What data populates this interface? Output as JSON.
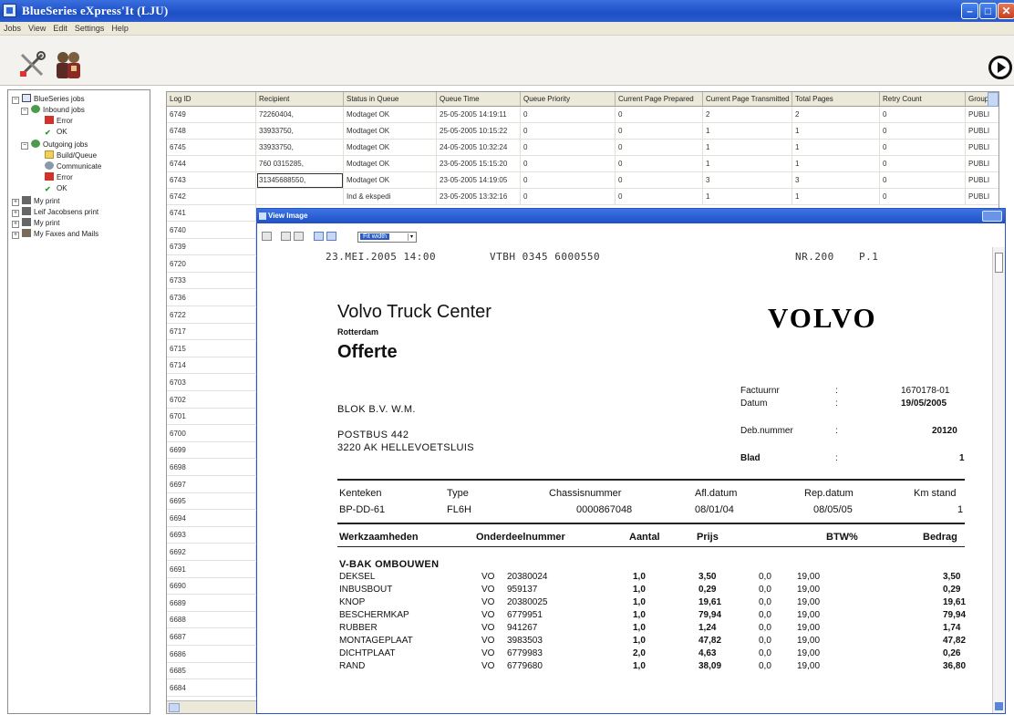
{
  "window": {
    "title": "BlueSeries eXpress'It (LJU)",
    "min": "–",
    "max": "□",
    "close": "✕"
  },
  "menu": [
    "Jobs",
    "View",
    "Edit",
    "Settings",
    "Help"
  ],
  "tree": [
    {
      "label": "BlueSeries jobs",
      "level": 0,
      "icon": "monitor-icon"
    },
    {
      "label": "Inbound jobs",
      "level": 1,
      "icon": "inbox-icon"
    },
    {
      "label": "Error",
      "level": 2,
      "icon": "error-icon"
    },
    {
      "label": "OK",
      "level": 2,
      "icon": "check-icon"
    },
    {
      "label": "Outgoing jobs",
      "level": 1,
      "icon": "outbox-icon"
    },
    {
      "label": "Build/Queue",
      "level": 2,
      "icon": "folder-icon"
    },
    {
      "label": "Communicate",
      "level": 2,
      "icon": "globe-icon"
    },
    {
      "label": "Error",
      "level": 2,
      "icon": "error-icon"
    },
    {
      "label": "OK",
      "level": 2,
      "icon": "check-icon"
    },
    {
      "label": "My print",
      "level": 0,
      "icon": "printer-icon"
    },
    {
      "label": "Leif Jacobsens print",
      "level": 0,
      "icon": "printer-icon"
    },
    {
      "label": "My print",
      "level": 0,
      "icon": "printer-icon"
    },
    {
      "label": "My Faxes and Mails",
      "level": 0,
      "icon": "fax-icon"
    }
  ],
  "grid": {
    "headers": [
      "Log ID",
      "Recipient",
      "Status in Queue",
      "Queue Time",
      "Queue Priority",
      "Current Page Prepared",
      "Current Page Transmitted",
      "Total Pages",
      "Retry Count",
      "Group"
    ],
    "rows": [
      [
        "6749",
        "72260404,",
        "Modtaget OK",
        "25-05-2005 14:19:11",
        "0",
        "0",
        "2",
        "2",
        "0",
        "PUBLI"
      ],
      [
        "6748",
        "33933750,",
        "Modtaget OK",
        "25-05-2005 10:15:22",
        "0",
        "0",
        "1",
        "1",
        "0",
        "PUBLI"
      ],
      [
        "6745",
        "33933750,",
        "Modtaget OK",
        "24-05-2005 10:32:24",
        "0",
        "0",
        "1",
        "1",
        "0",
        "PUBLI"
      ],
      [
        "6744",
        "760 0315285,",
        "Modtaget OK",
        "23-05-2005 15:15:20",
        "0",
        "0",
        "1",
        "1",
        "0",
        "PUBLI"
      ],
      [
        "6743",
        "31345688550,",
        "Modtaget OK",
        "23-05-2005 14:19:05",
        "0",
        "0",
        "3",
        "3",
        "0",
        "PUBLI"
      ],
      [
        "6742",
        "",
        "Ind & ekspedi",
        "23-05-2005 13:32:16",
        "0",
        "0",
        "1",
        "1",
        "0",
        "PUBLI"
      ]
    ],
    "ids": [
      "6741",
      "6740",
      "6739",
      "6720",
      "6733",
      "6736",
      "6722",
      "6717",
      "6715",
      "6714",
      "6703",
      "6702",
      "6701",
      "6700",
      "6699",
      "6698",
      "6697",
      "6695",
      "6694",
      "6693",
      "6692",
      "6691",
      "6690",
      "6689",
      "6688",
      "6687",
      "6686",
      "6685",
      "6684"
    ]
  },
  "viewer": {
    "title": "View Image",
    "zoom": "Fit width",
    "fax_header": {
      "date": "23.MEI.2005  14:00",
      "from": "VTBH 0345 6000550",
      "nr": "NR.200",
      "page": "P.1"
    },
    "doc": {
      "company": "Volvo Truck Center",
      "city": "Rotterdam",
      "title": "Offerte",
      "logo": "VOLVO",
      "meta": [
        {
          "label": "Factuurnr",
          "value": "1670178-01"
        },
        {
          "label": "Datum",
          "value": "19/05/2005"
        },
        {
          "label": "Deb.nummer",
          "value": "20120"
        },
        {
          "label": "Blad",
          "value": "1"
        }
      ],
      "address": [
        "BLOK B.V. W.M.",
        "POSTBUS 442",
        "3220 AK    HELLEVOETSLUIS"
      ],
      "vehicle_headers": [
        "Kenteken",
        "Type",
        "Chassisnummer",
        "Afl.datum",
        "Rep.datum",
        "Km stand"
      ],
      "vehicle_values": [
        "BP-DD-61",
        "FL6H",
        "0000867048",
        "08/01/04",
        "08/05/05",
        "1"
      ],
      "line_headers": [
        "Werkzaamheden",
        "Onderdeelnummer",
        "Aantal",
        "Prijs",
        "BTW%",
        "Bedrag"
      ],
      "section": "V-BAK OMBOUWEN",
      "lines": [
        [
          "DEKSEL",
          "VO",
          "20380024",
          "1,0",
          "3,50",
          "0,0",
          "19,00",
          "3,50"
        ],
        [
          "INBUSBOUT",
          "VO",
          "959137",
          "1,0",
          "0,29",
          "0,0",
          "19,00",
          "0,29"
        ],
        [
          "KNOP",
          "VO",
          "20380025",
          "1,0",
          "19,61",
          "0,0",
          "19,00",
          "19,61"
        ],
        [
          "BESCHERMKAP",
          "VO",
          "6779951",
          "1,0",
          "79,94",
          "0,0",
          "19,00",
          "79,94"
        ],
        [
          "RUBBER",
          "VO",
          "941267",
          "1,0",
          "1,24",
          "0,0",
          "19,00",
          "1,74"
        ],
        [
          "MONTAGEPLAAT",
          "VO",
          "3983503",
          "1,0",
          "47,82",
          "0,0",
          "19,00",
          "47,82"
        ],
        [
          "DICHTPLAAT",
          "VO",
          "6779983",
          "2,0",
          "4,63",
          "0,0",
          "19,00",
          "0,26"
        ],
        [
          "RAND",
          "VO",
          "6779680",
          "1,0",
          "38,09",
          "0,0",
          "19,00",
          "36,80"
        ]
      ]
    }
  }
}
